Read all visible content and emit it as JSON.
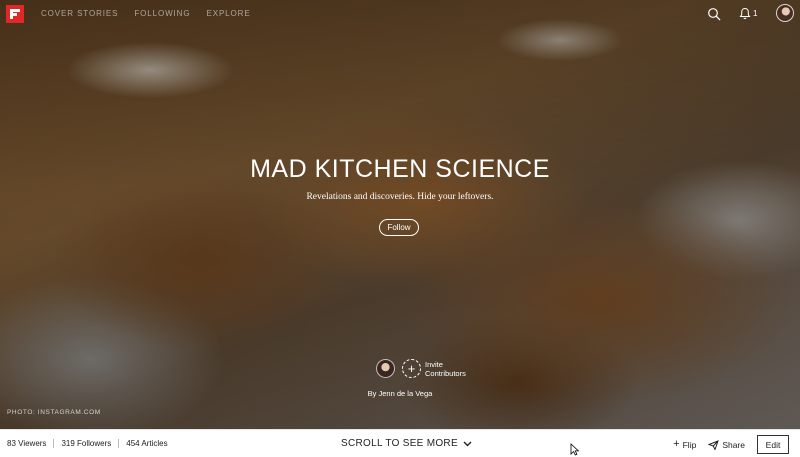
{
  "nav": {
    "items": [
      "Cover Stories",
      "Following",
      "Explore"
    ],
    "notification_count": "1"
  },
  "magazine": {
    "title": "MAD KITCHEN SCIENCE",
    "subtitle": "Revelations and discoveries. Hide your leftovers.",
    "follow_label": "Follow",
    "invite_label_line1": "Invite",
    "invite_label_line2": "Contributors",
    "byline": "By Jenn de la Vega",
    "photo_credit": "PHOTO: INSTAGRAM.COM"
  },
  "stats": {
    "viewers": "83 Viewers",
    "followers": "319 Followers",
    "articles": "454 Articles"
  },
  "bottom": {
    "scroll_label": "SCROLL TO SEE MORE",
    "flip_label": "Flip",
    "share_label": "Share",
    "edit_label": "Edit"
  },
  "colors": {
    "brand_red": "#e12828",
    "text_dark": "#222222"
  }
}
